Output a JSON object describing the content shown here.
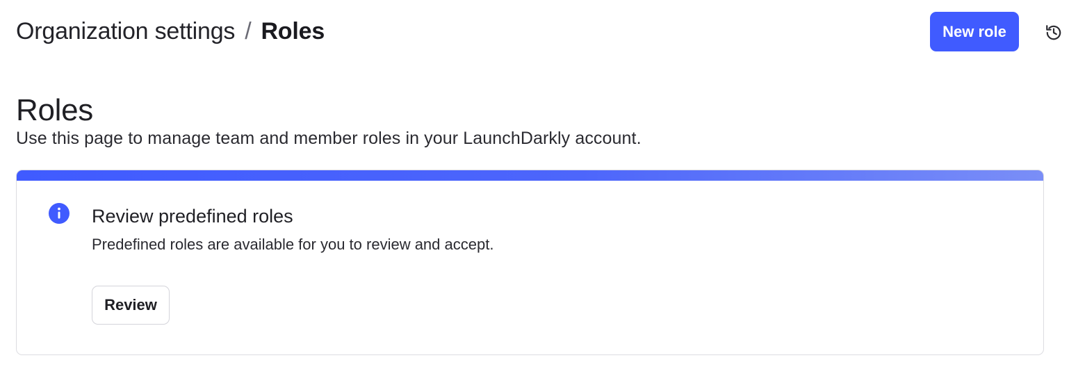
{
  "header": {
    "breadcrumb": {
      "parent": "Organization settings",
      "separator": "/",
      "current": "Roles"
    },
    "new_role_label": "New role",
    "history_icon": "history-clock-icon"
  },
  "page": {
    "title": "Roles",
    "description": "Use this page to manage team and member roles in your LaunchDarkly account."
  },
  "callout": {
    "icon": "info-icon",
    "title": "Review predefined roles",
    "body": "Predefined roles are available for you to review and accept.",
    "button_label": "Review"
  },
  "colors": {
    "accent": "#405bff",
    "text": "#1f1f24",
    "border": "#dcdce1"
  }
}
